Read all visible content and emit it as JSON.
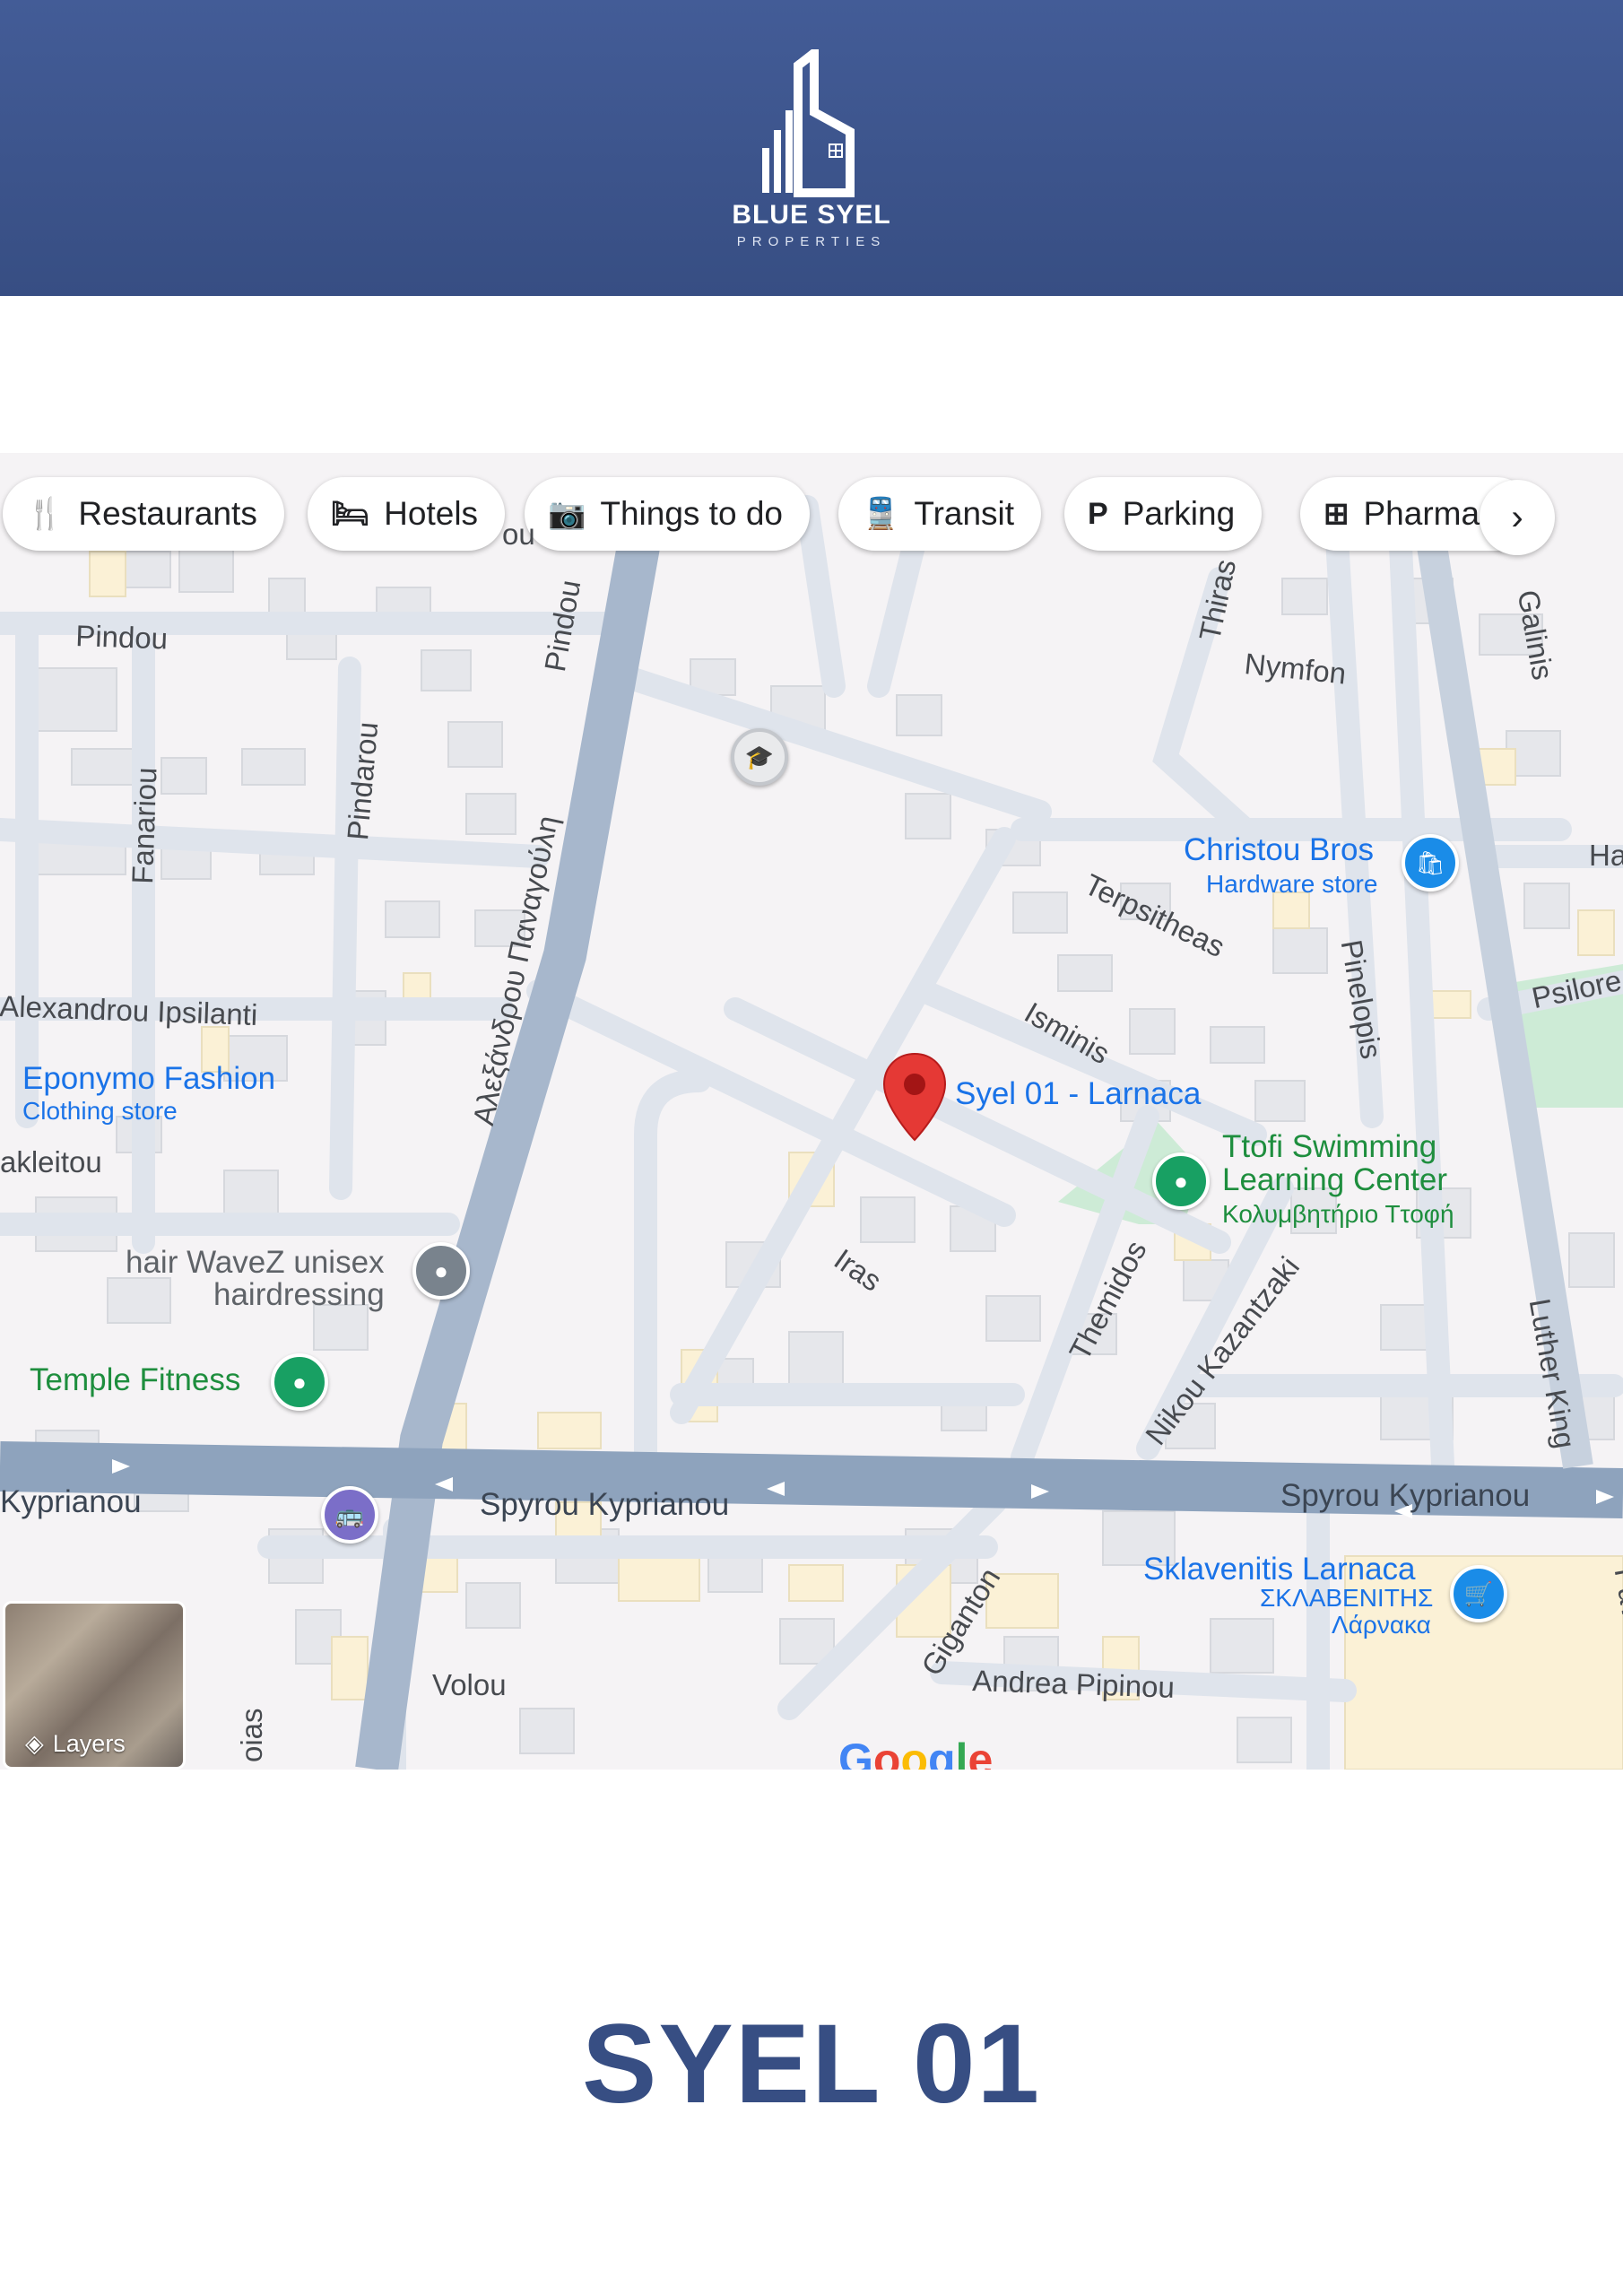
{
  "brand": {
    "name": "BLUE SYEL",
    "tagline": "PROPERTIES",
    "header_color": "#3f5690"
  },
  "map": {
    "chips": [
      {
        "label": "Restaurants",
        "icon": "restaurant-icon"
      },
      {
        "label": "Hotels",
        "icon": "hotel-icon"
      },
      {
        "label": "Things to do",
        "icon": "camera-icon"
      },
      {
        "label": "Transit",
        "icon": "transit-icon"
      },
      {
        "label": "Parking",
        "icon": "parking-icon"
      },
      {
        "label": "Pharma",
        "icon": "pharmacy-icon"
      }
    ],
    "streets": {
      "pindou_left": "Pindou",
      "pindou_vertical": "Pindou",
      "pindarou": "Pindarou",
      "fanariou": "Fanariou",
      "alexandrou": "Alexandrou Ipsilanti",
      "panagouli": "Αλεξάνδρου Παναγούλη",
      "akleitou": "akleitou",
      "thiras": "Thiras",
      "nymfon": "Nymfon",
      "galinis": "Galinis",
      "terpsitheas": "Terpsitheas",
      "pinelopis": "Pinelopis",
      "psilore": "Psilore",
      "isminis": "Isminis",
      "iras": "Iras",
      "themidos": "Themidos",
      "nikou": "Nikou Kazantzaki",
      "luther": "Luther King",
      "kyprianou_left": "Kyprianou",
      "kyprianou_center": "Spyrou Kyprianou",
      "kyprianou_right": "Spyrou Kyprianou",
      "giganton": "Giganton",
      "andrea": "Andrea Pipinou",
      "volou": "Volou",
      "pavlou": "Pavlou",
      "oias": "oias",
      "ha": "Ha",
      "top_fragment": "ou"
    },
    "places": {
      "syel": {
        "title": "Syel 01 - Larnaca"
      },
      "christou": {
        "title": "Christou Bros",
        "subtitle": "Hardware store"
      },
      "eponymo": {
        "title": "Eponymo Fashion",
        "subtitle": "Clothing store"
      },
      "ttofi": {
        "title_line1": "Ttofi Swimming",
        "title_line2": "Learning Center",
        "subtitle": "Κολυμβητήριο Ττοφή"
      },
      "hairwavez": {
        "title_line1": "hair WaveZ unisex",
        "title_line2": "hairdressing"
      },
      "temple": {
        "title": "Temple Fitness"
      },
      "sklavenitis": {
        "title": "Sklavenitis Larnaca",
        "subtitle_line1": "ΣΚΛΑΒΕΝΙΤΗΣ",
        "subtitle_line2": "Λάρνακα"
      }
    },
    "layers_label": "Layers",
    "google_logo": "Google",
    "colors": {
      "road_major": "#8ea3bd",
      "road_minor": "#dfe4ec",
      "park": "#cdebd6",
      "pin": "#e53935"
    }
  },
  "property_title": "SYEL 01"
}
